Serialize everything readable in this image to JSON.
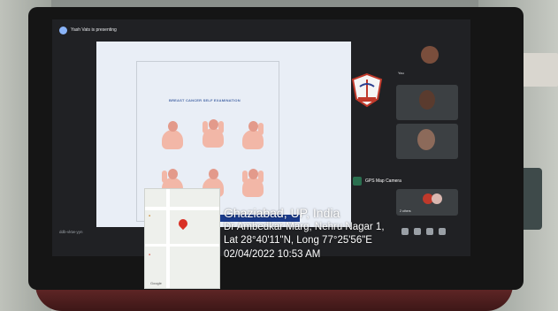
{
  "meeting": {
    "presenter_text": "Yash Vats is presenting",
    "slide_title": "BREAST CANCER SELF EXAMINATION",
    "meeting_code": "ddb-vktw-yyn"
  },
  "participants": {
    "you_label": "You",
    "others_label": "2 others"
  },
  "gps_app": {
    "name": "GPS Map Camera"
  },
  "location": {
    "city": "Ghaziabad, UP, India",
    "address": "Dr Ambedkar Marg, Nehru Nagar 1,",
    "coords": "Lat 28°40'11\"N, Long 77°25'56\"E",
    "datetime": "02/04/2022 10:53 AM"
  },
  "map": {
    "brand": "Google"
  },
  "colors": {
    "pin": "#d93025",
    "slide_title": "#4b6aa8",
    "figure_skin": "#f2b7a7"
  }
}
